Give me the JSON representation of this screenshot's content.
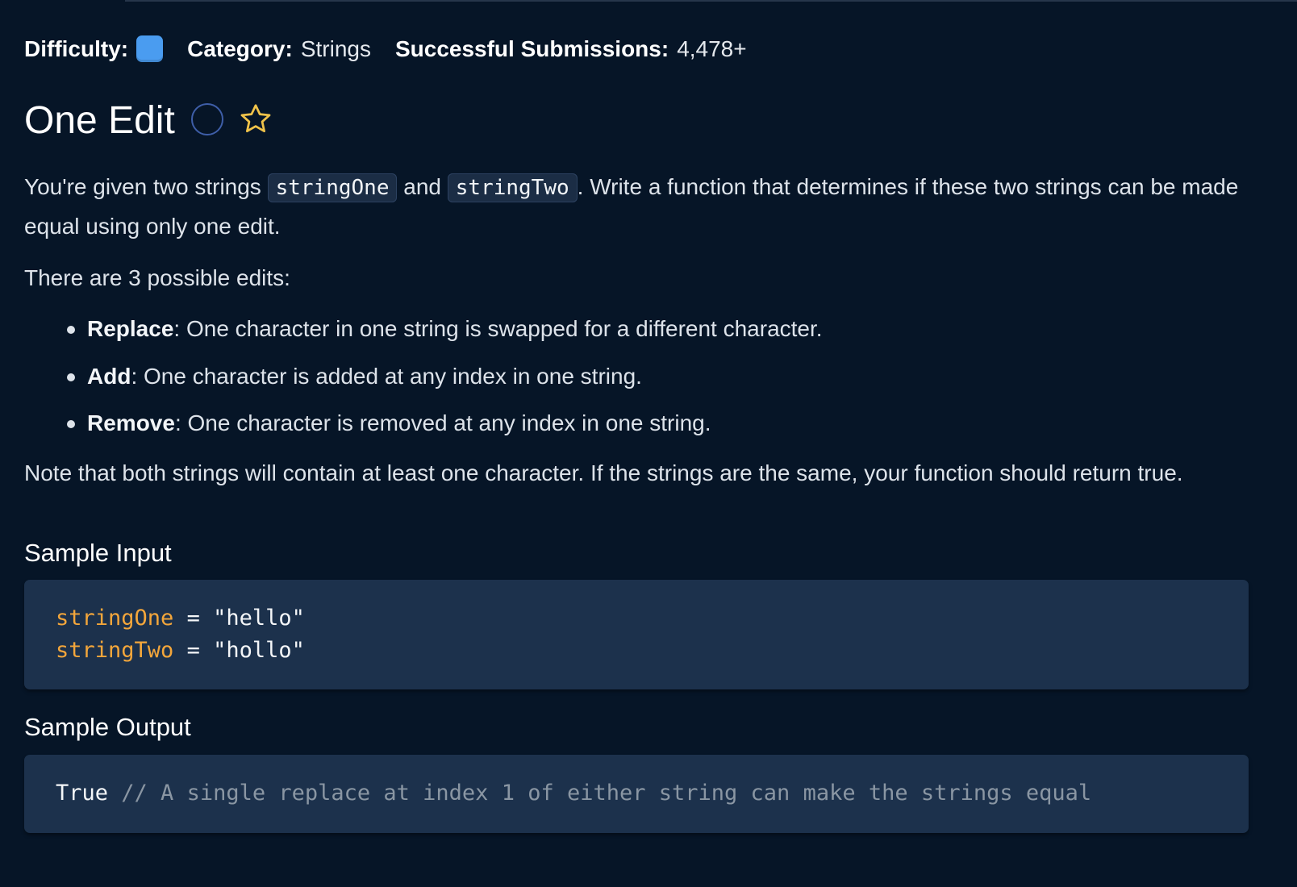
{
  "meta": {
    "difficulty_label": "Difficulty:",
    "difficulty_color": "#4a9cf0",
    "category_label": "Category:",
    "category_value": "Strings",
    "submissions_label": "Successful Submissions:",
    "submissions_value": "4,478+"
  },
  "question": {
    "title": "One Edit",
    "status_icon": "empty-circle-icon",
    "favorite_icon": "star-outline-icon",
    "favorite_color": "#f0c34a"
  },
  "prompt": {
    "intro_before": "You're given two strings ",
    "intro_code_1": "stringOne",
    "intro_between": " and ",
    "intro_code_2": "stringTwo",
    "intro_after": ". Write a function that determines if these two strings can be made equal using only one edit.",
    "edits_intro": "There are 3 possible edits:",
    "edits": [
      {
        "name": "Replace",
        "desc": ": One character in one string is swapped for a different character."
      },
      {
        "name": "Add",
        "desc": ": One character is added at any index in one string."
      },
      {
        "name": "Remove",
        "desc": ": One character is removed at any index in one string."
      }
    ],
    "note": "Note that both strings will contain at least one character. If the strings are the same, your function should return true."
  },
  "sample_input": {
    "heading": "Sample Input",
    "lines": [
      {
        "var": "stringOne",
        "op": " = ",
        "value": "\"hello\""
      },
      {
        "var": "stringTwo",
        "op": " = ",
        "value": "\"hollo\""
      }
    ]
  },
  "sample_output": {
    "heading": "Sample Output",
    "value": "True",
    "comment": " // A single replace at index 1 of either string can make the strings equal"
  },
  "colors": {
    "background": "#061527",
    "code_background": "#1c314c",
    "variable": "#f3a63b",
    "comment": "#8a96a3"
  }
}
